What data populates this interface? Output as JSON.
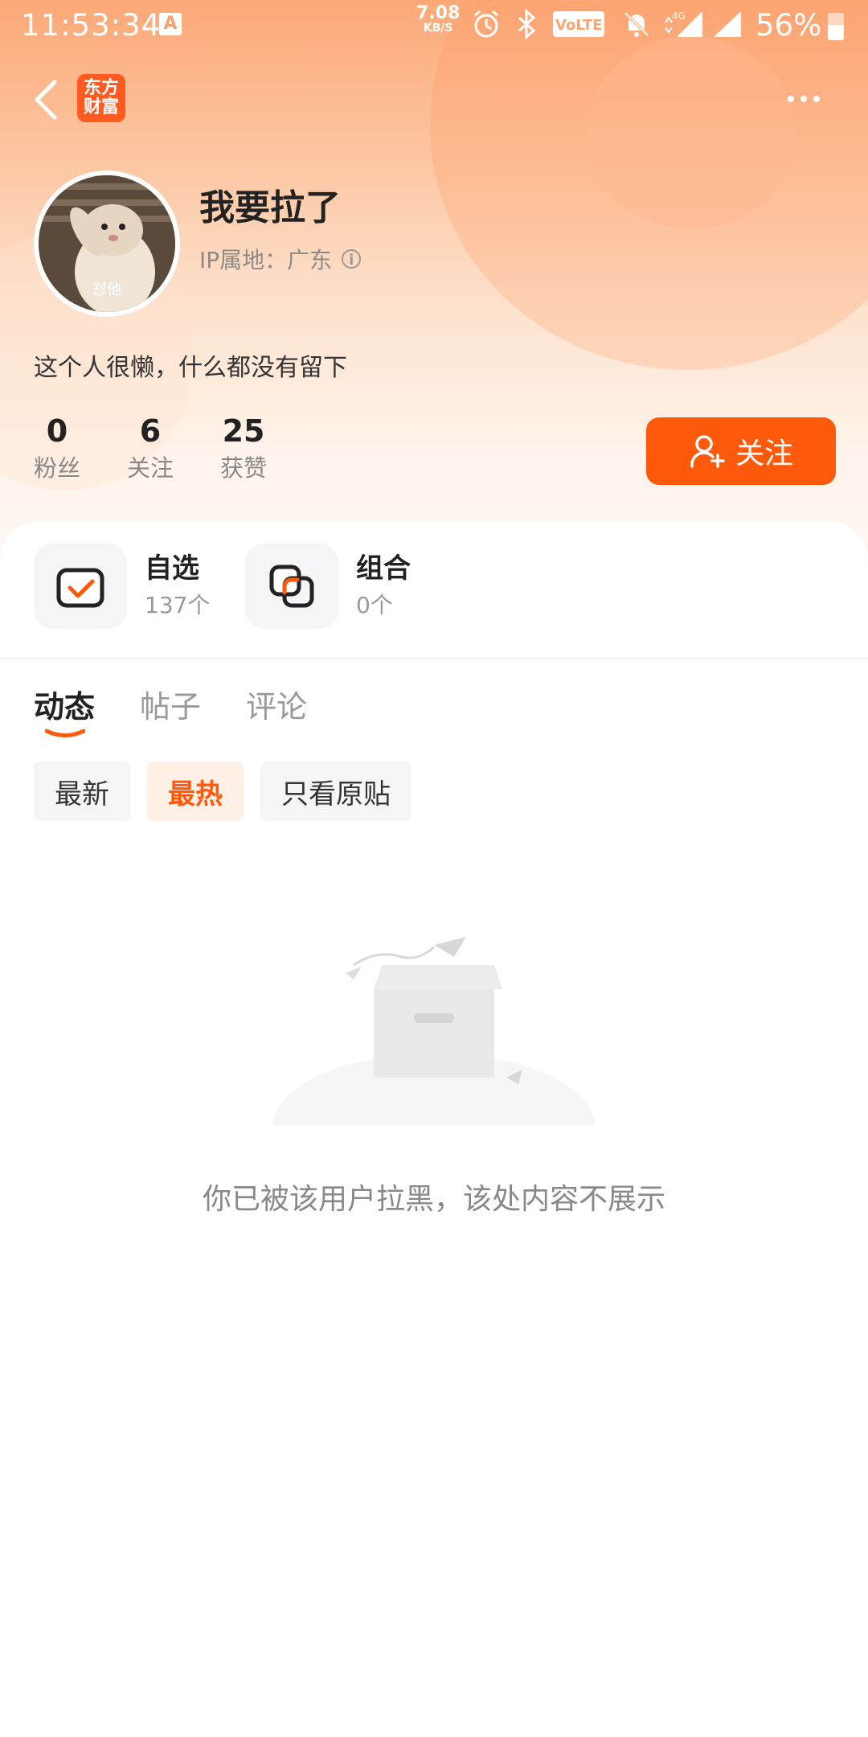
{
  "status_bar": {
    "time": "11:53:34",
    "a_badge": "A",
    "net_speed_value": "7.08",
    "net_speed_unit": "KB/S",
    "volte": "VoLTE",
    "network": "4G",
    "battery_percent": "56%",
    "battery_level": 0.56
  },
  "nav": {
    "logo_line1": "东方",
    "logo_line2": "财富"
  },
  "profile": {
    "avatar_caption": "怼他",
    "username": "我要拉了",
    "ip_location": "IP属地：广东",
    "bio": "这个人很懒，什么都没有留下",
    "follow_label": "关注"
  },
  "stats": [
    {
      "value": "0",
      "label": "粉丝"
    },
    {
      "value": "6",
      "label": "关注"
    },
    {
      "value": "25",
      "label": "获赞"
    }
  ],
  "shortcuts": [
    {
      "title": "自选",
      "sub": "137个",
      "icon": "watchlist-icon"
    },
    {
      "title": "组合",
      "sub": "0个",
      "icon": "portfolio-icon"
    }
  ],
  "tabs": [
    {
      "label": "动态",
      "active": true
    },
    {
      "label": "帖子",
      "active": false
    },
    {
      "label": "评论",
      "active": false
    }
  ],
  "filters": [
    {
      "label": "最新",
      "active": false
    },
    {
      "label": "最热",
      "active": true
    },
    {
      "label": "只看原贴",
      "active": false
    }
  ],
  "empty_message": "你已被该用户拉黑，该处内容不展示",
  "colors": {
    "accent": "#ff5a0b",
    "header_gradient_top": "#fba877",
    "muted_text": "#999999"
  }
}
